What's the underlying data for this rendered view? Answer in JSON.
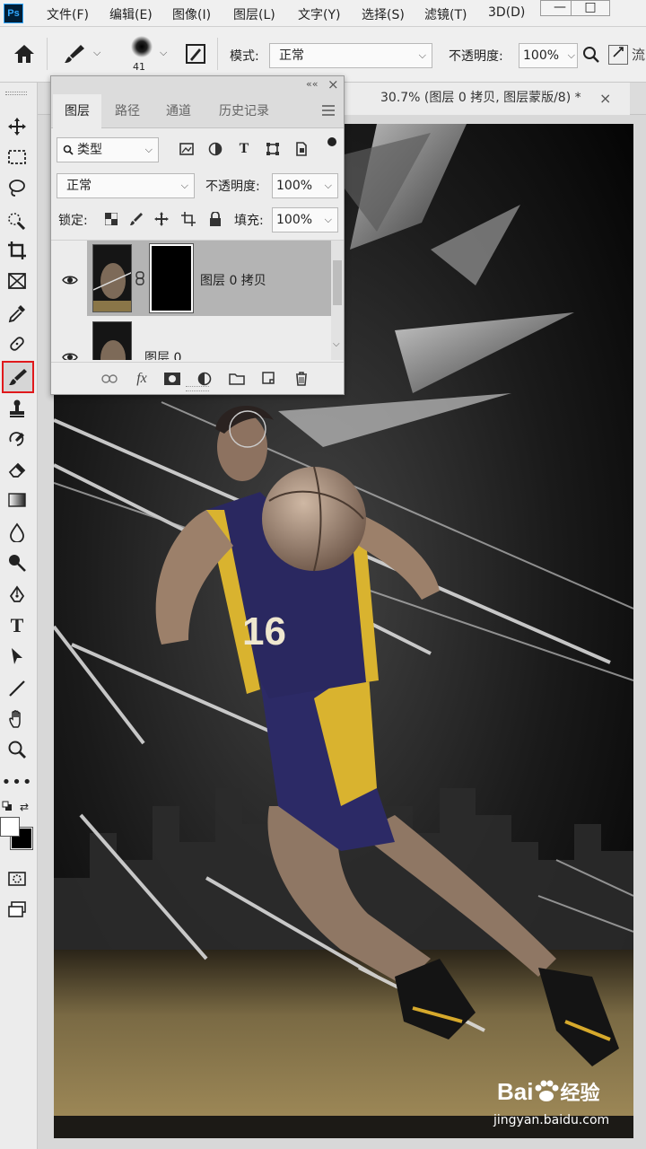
{
  "app": {
    "logo_text": "Ps"
  },
  "menu": {
    "items": [
      "文件(F)",
      "编辑(E)",
      "图像(I)",
      "图层(L)",
      "文字(Y)",
      "选择(S)",
      "滤镜(T)",
      "3D(D)"
    ],
    "window_buttons": [
      "—",
      "□"
    ]
  },
  "options_bar": {
    "brush_size": "41",
    "mode_label": "模式:",
    "mode_value": "正常",
    "opacity_label": "不透明度:",
    "opacity_value": "100%",
    "cut_text": "流"
  },
  "document": {
    "tab_title": "30.7% (图层 0 拷贝, 图层蒙版/8) *",
    "close_glyph": "×"
  },
  "layers_panel": {
    "collapse_glyph": "««",
    "close_glyph": "×",
    "tabs": [
      "图层",
      "路径",
      "通道",
      "历史记录"
    ],
    "active_tab": "图层",
    "filter_label": "类型",
    "blend_mode": "正常",
    "opacity_label": "不透明度:",
    "opacity_value": "100%",
    "lock_label": "锁定:",
    "fill_label": "填充:",
    "fill_value": "100%",
    "layers": [
      {
        "name": "图层 0 拷贝",
        "visible": true,
        "selected": true,
        "has_mask": true
      },
      {
        "name": "图层 0",
        "visible": true,
        "selected": false,
        "has_mask": false
      }
    ],
    "fx_label": "fx"
  },
  "artwork": {
    "jersey_number": "16"
  },
  "watermark": {
    "brand": "Bai",
    "brand_cn": "经验",
    "url": "jingyan.baidu.com"
  },
  "colors": {
    "active_tool_border": "#e0191c",
    "panel_bg": "#ececec",
    "menu_bg": "#f0f0f0"
  }
}
